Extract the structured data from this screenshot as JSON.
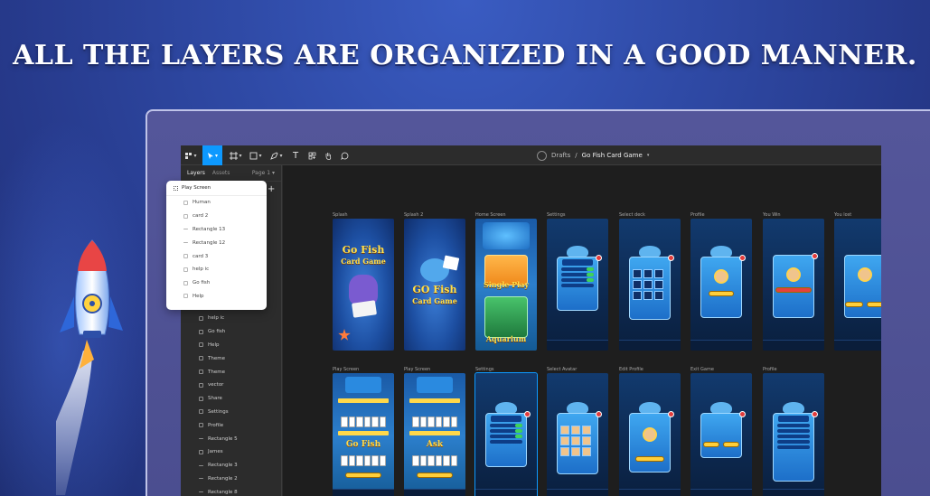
{
  "headline": "ALL THE LAYERS ARE ORGANIZED IN A GOOD MANNER.",
  "colors": {
    "accent": "#0d99ff",
    "background": "#2f4aa6",
    "canvas": "#1e1e1e"
  },
  "toolbar": {
    "tools": [
      "main-menu-icon",
      "move-tool-icon",
      "frame-tool-icon",
      "shape-tool-icon",
      "pen-tool-icon",
      "text-tool-icon",
      "resources-icon",
      "hand-tool-icon",
      "comment-icon"
    ],
    "breadcrumb": {
      "root": "Drafts",
      "separator": "/",
      "file": "Go Fish Card Game"
    }
  },
  "sidebar": {
    "tabs": {
      "layers": "Layers",
      "assets": "Assets",
      "page": "Page 1"
    },
    "layers": [
      {
        "label": "help ic"
      },
      {
        "label": "Go fish"
      },
      {
        "label": "Help"
      },
      {
        "label": "Theme"
      },
      {
        "label": "Theme"
      },
      {
        "label": "vector"
      },
      {
        "label": "Share"
      },
      {
        "label": "Settings"
      },
      {
        "label": "Profile"
      },
      {
        "label": "Rectangle 5"
      },
      {
        "label": "James"
      },
      {
        "label": "Rectangle 3"
      },
      {
        "label": "Rectangle 2"
      },
      {
        "label": "Rectangle 8"
      }
    ]
  },
  "popup": {
    "title": "Play Screen",
    "items": [
      {
        "label": "Human"
      },
      {
        "label": "card 2"
      },
      {
        "label": "Rectangle 13"
      },
      {
        "label": "Rectangle 12"
      },
      {
        "label": "card 3"
      },
      {
        "label": "help ic"
      },
      {
        "label": "Go fish"
      },
      {
        "label": "Help"
      }
    ]
  },
  "canvas": {
    "row1": [
      {
        "label": "Splash"
      },
      {
        "label": "Splash 2"
      },
      {
        "label": "Home Screen"
      },
      {
        "label": "Settings"
      },
      {
        "label": "Select deck"
      },
      {
        "label": "Profile"
      },
      {
        "label": "You Win"
      },
      {
        "label": "You lost"
      }
    ],
    "row2": [
      {
        "label": "Play Screen"
      },
      {
        "label": "Play Screen"
      },
      {
        "label": "Settings"
      },
      {
        "label": "Select Avatar"
      },
      {
        "label": "Edit Profile"
      },
      {
        "label": "Exit Game"
      },
      {
        "label": "Profile"
      }
    ],
    "art_text": {
      "splash_logo_1": "Go Fish",
      "splash_logo_2": "Card Game",
      "splash2_logo_1": "GO Fish",
      "splash2_logo_2": "Card Game",
      "home_btn_1": "Single Play",
      "home_btn_2": "Aquarium",
      "play_title_1": "Go Fish",
      "play_title_2": "Ask"
    }
  }
}
